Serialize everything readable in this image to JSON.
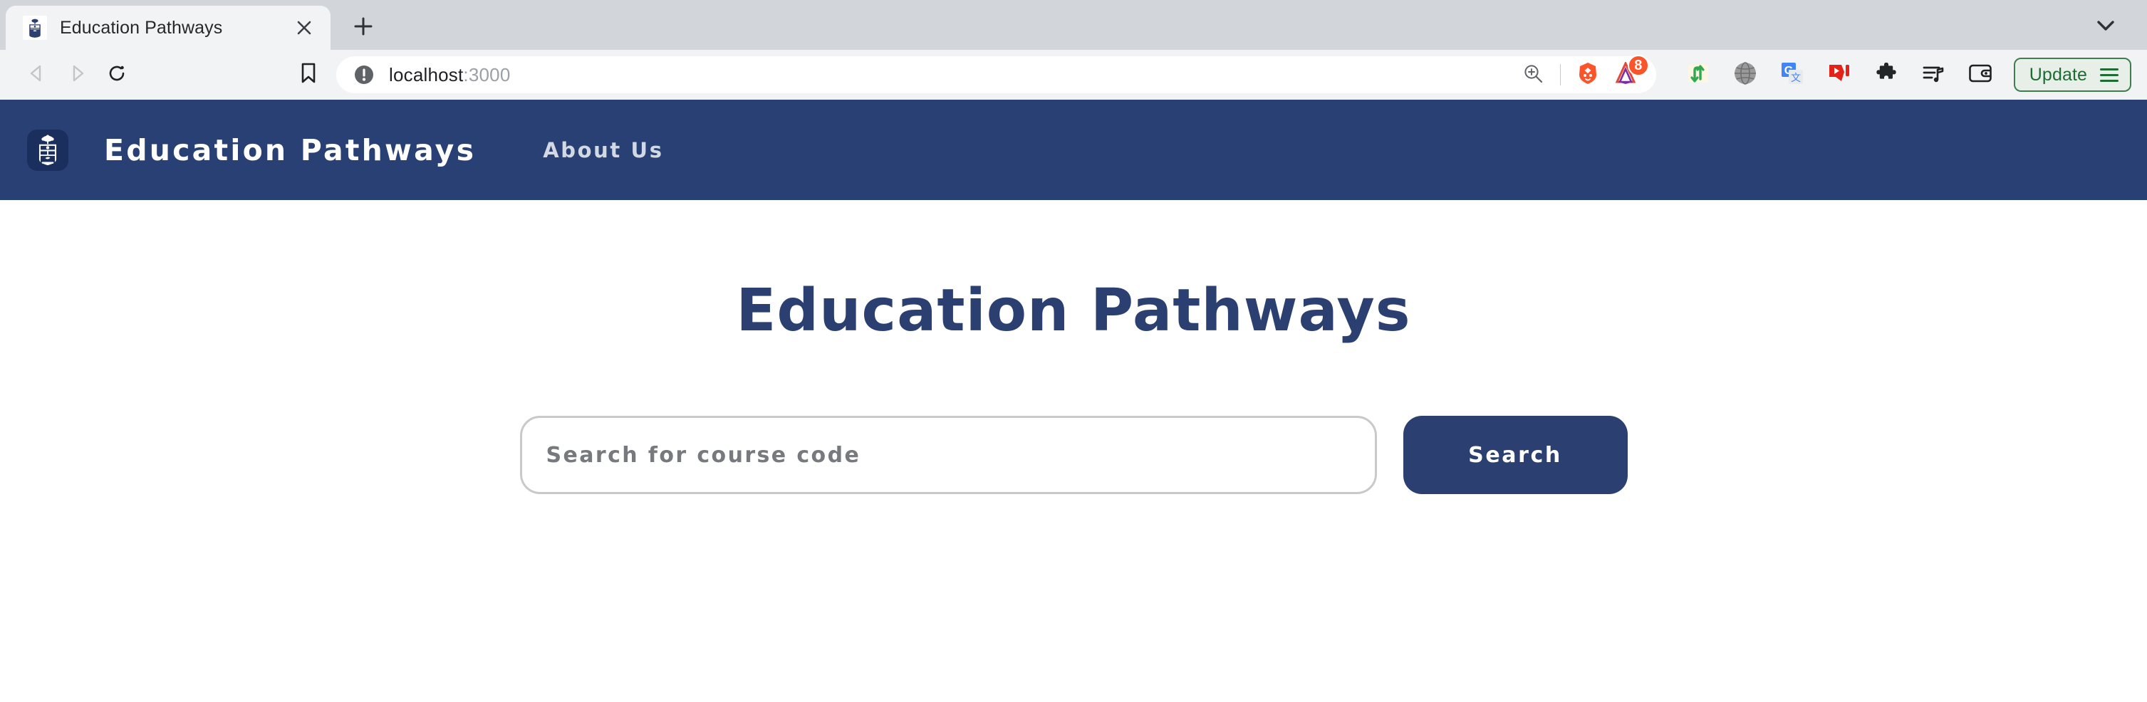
{
  "browser": {
    "name": "brave-browser",
    "tab": {
      "title": "Education Pathways",
      "favicon_icon": "uoft-crest-favicon",
      "close_icon": "close-icon"
    },
    "new_tab_icon": "plus-icon",
    "tab_list_chevron_icon": "chevron-down-icon",
    "nav": {
      "back_icon": "back-arrow-icon",
      "forward_icon": "forward-arrow-icon",
      "reload_icon": "reload-icon",
      "bookmark_icon": "bookmark-icon"
    },
    "urlbar": {
      "info_icon": "not-secure-info-icon",
      "host": "localhost",
      "port": ":3000",
      "full_url": "localhost:3000",
      "zoom_icon": "zoom-in-icon",
      "shields_icon": "brave-shields-lion-icon",
      "rewards_icon": "brave-rewards-bat-icon",
      "rewards_badge": "8"
    },
    "extensions": [
      {
        "icon": "sync-arrows-icon",
        "label": "Sync arrows extension"
      },
      {
        "icon": "sphere-icon",
        "label": "Sphere extension"
      },
      {
        "icon": "google-translate-icon",
        "label": "Google Translate"
      },
      {
        "icon": "youtube-dislike-icon",
        "label": "Return YouTube Dislike"
      },
      {
        "icon": "puzzle-piece-icon",
        "label": "Extensions"
      },
      {
        "icon": "playlist-icon",
        "label": "Brave Playlist"
      },
      {
        "icon": "wallet-icon",
        "label": "Brave Wallet"
      }
    ],
    "update_button": {
      "label": "Update",
      "menu_icon": "hamburger-menu-icon"
    }
  },
  "page": {
    "header": {
      "logo_icon": "uoft-crest-logo",
      "brand": "Education Pathways",
      "nav_items": [
        {
          "label": "About Us"
        }
      ]
    },
    "hero": {
      "title": "Education Pathways"
    },
    "search": {
      "placeholder": "Search for course code",
      "value": "",
      "button_label": "Search"
    },
    "colors": {
      "navy": "#284073",
      "navy_dark": "#1b2f5e",
      "title_navy": "#2b4070",
      "nav_link": "#d2d8e4",
      "placeholder_gray": "#76797d",
      "input_border": "#c8c9cb",
      "update_green": "#1e6b34",
      "bat_orange": "#fb542b"
    }
  }
}
